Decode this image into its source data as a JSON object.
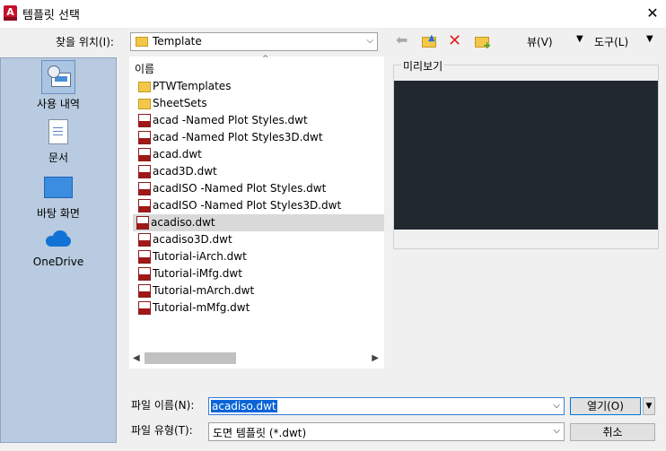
{
  "window": {
    "title": "템플릿 선택",
    "app_icon_letter": "A"
  },
  "lookin": {
    "label": "찾을 위치(I):",
    "value": "Template"
  },
  "toolbar": {
    "views_label": "뷰(V)",
    "tools_label": "도구(L)"
  },
  "places": [
    {
      "label": "사용 내역",
      "icon": "history-icon"
    },
    {
      "label": "문서",
      "icon": "documents-icon"
    },
    {
      "label": "바탕 화면",
      "icon": "desktop-icon"
    },
    {
      "label": "OneDrive",
      "icon": "onedrive-icon"
    }
  ],
  "filelist": {
    "column_header": "이름",
    "items": [
      {
        "name": "PTWTemplates",
        "type": "folder"
      },
      {
        "name": "SheetSets",
        "type": "folder"
      },
      {
        "name": "acad -Named Plot Styles.dwt",
        "type": "dwt"
      },
      {
        "name": "acad -Named Plot Styles3D.dwt",
        "type": "dwt"
      },
      {
        "name": "acad.dwt",
        "type": "dwt"
      },
      {
        "name": "acad3D.dwt",
        "type": "dwt"
      },
      {
        "name": "acadISO -Named Plot Styles.dwt",
        "type": "dwt"
      },
      {
        "name": "acadISO -Named Plot Styles3D.dwt",
        "type": "dwt"
      },
      {
        "name": "acadiso.dwt",
        "type": "dwt",
        "selected": true
      },
      {
        "name": "acadiso3D.dwt",
        "type": "dwt"
      },
      {
        "name": "Tutorial-iArch.dwt",
        "type": "dwt"
      },
      {
        "name": "Tutorial-iMfg.dwt",
        "type": "dwt"
      },
      {
        "name": "Tutorial-mArch.dwt",
        "type": "dwt"
      },
      {
        "name": "Tutorial-mMfg.dwt",
        "type": "dwt"
      }
    ]
  },
  "preview": {
    "label": "미리보기"
  },
  "filename": {
    "label": "파일 이름(N):",
    "value": "acadiso.dwt"
  },
  "filetype": {
    "label": "파일 유형(T):",
    "value": "도면 템플릿 (*.dwt)"
  },
  "buttons": {
    "open": "열기(O)",
    "cancel": "취소"
  },
  "colors": {
    "preview_bg": "#212830",
    "places_bg": "#b9cbe0",
    "selection": "#0a64d8"
  }
}
